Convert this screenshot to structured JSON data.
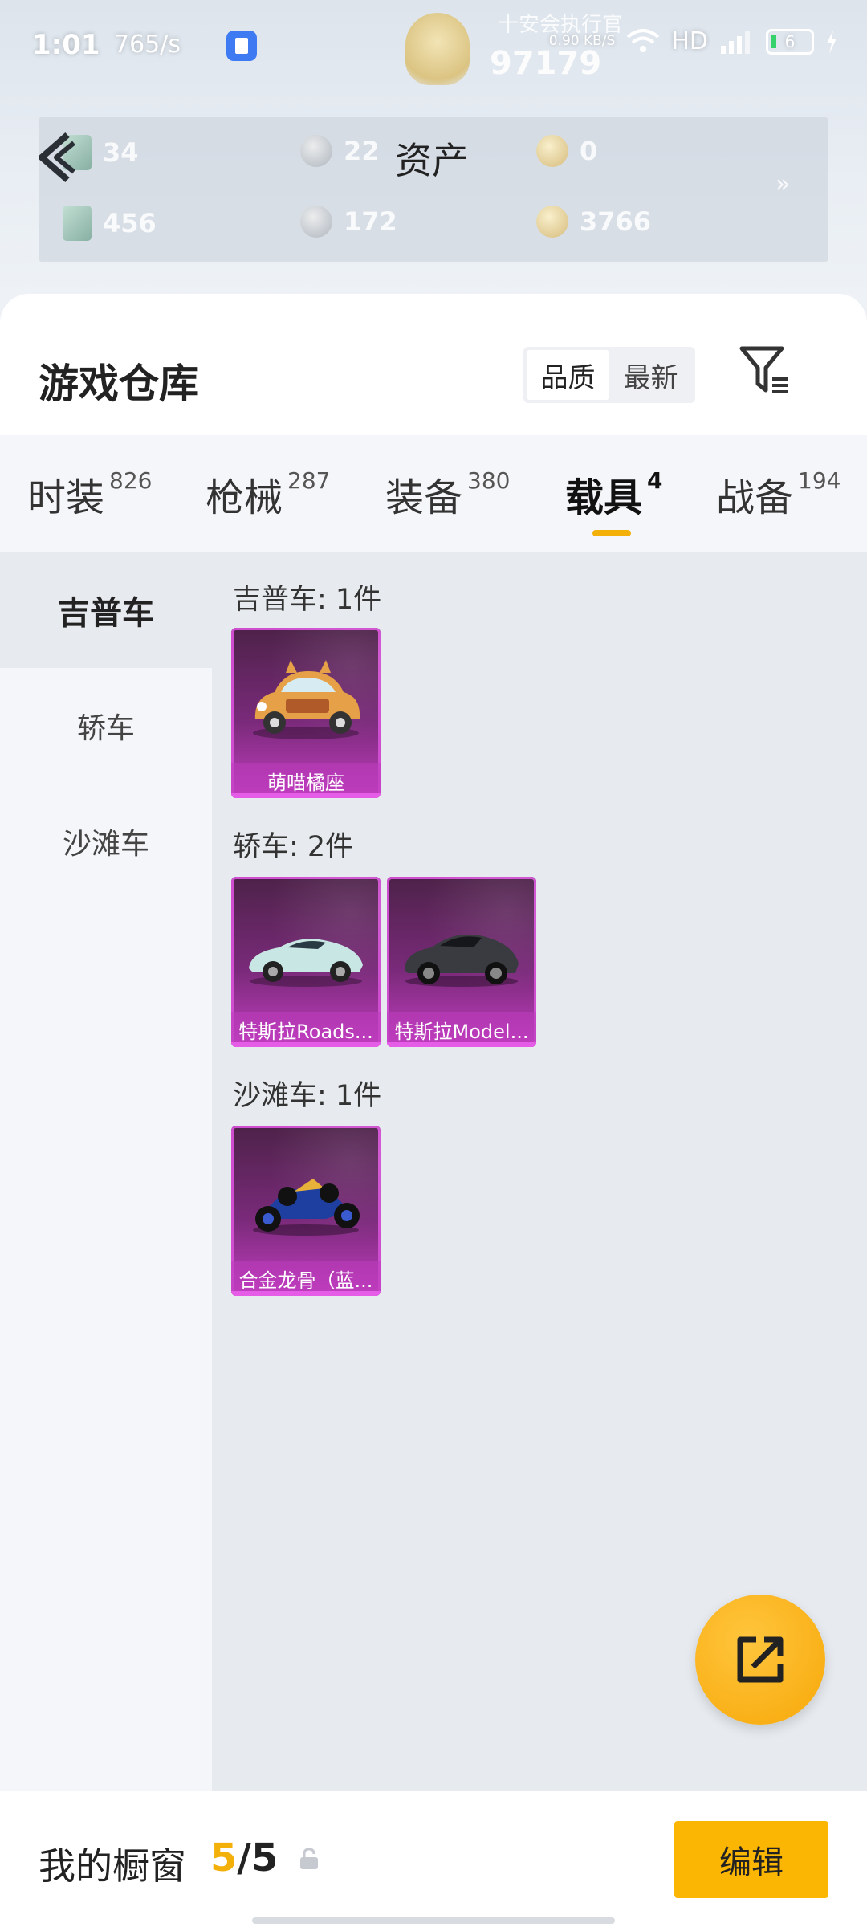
{
  "status_bar": {
    "time": "1:01",
    "speed": "765/s",
    "net": "0.90 KB/S",
    "network_type": "HD",
    "battery": "6"
  },
  "header": {
    "player_name": "十安会执行官",
    "player_score": "97179"
  },
  "assets": {
    "title": "资产",
    "items": [
      {
        "value": "34",
        "icon": "card-icon"
      },
      {
        "value": "22",
        "icon": "silver-coin-icon"
      },
      {
        "value": "0",
        "icon": "gold-coin-icon"
      },
      {
        "value": "456",
        "icon": "green-card-icon"
      },
      {
        "value": "172",
        "icon": "silver-coin-icon"
      },
      {
        "value": "3766",
        "icon": "gold-coin-icon"
      }
    ]
  },
  "warehouse": {
    "title": "游戏仓库",
    "sort": {
      "quality": "品质",
      "newest": "最新"
    }
  },
  "tabs": [
    {
      "label": "时装",
      "count": "826"
    },
    {
      "label": "枪械",
      "count": "287"
    },
    {
      "label": "装备",
      "count": "380"
    },
    {
      "label": "载具",
      "count": "4"
    },
    {
      "label": "战备",
      "count": "194"
    }
  ],
  "sidebar": [
    {
      "label": "吉普车"
    },
    {
      "label": "轿车"
    },
    {
      "label": "沙滩车"
    }
  ],
  "sections": [
    {
      "title": "吉普车: 1件",
      "items": [
        {
          "name": "萌喵橘座"
        }
      ]
    },
    {
      "title": "轿车: 2件",
      "items": [
        {
          "name": "特斯拉Roads..."
        },
        {
          "name": "特斯拉Model..."
        }
      ]
    },
    {
      "title": "沙滩车: 1件",
      "items": [
        {
          "name": "合金龙骨（蓝..."
        }
      ]
    }
  ],
  "bottom_bar": {
    "label": "我的橱窗",
    "current": "5",
    "separator": "/",
    "total": "5",
    "edit": "编辑"
  },
  "colors": {
    "accent": "#f3b008",
    "item_frame": "#cf4ed0"
  }
}
